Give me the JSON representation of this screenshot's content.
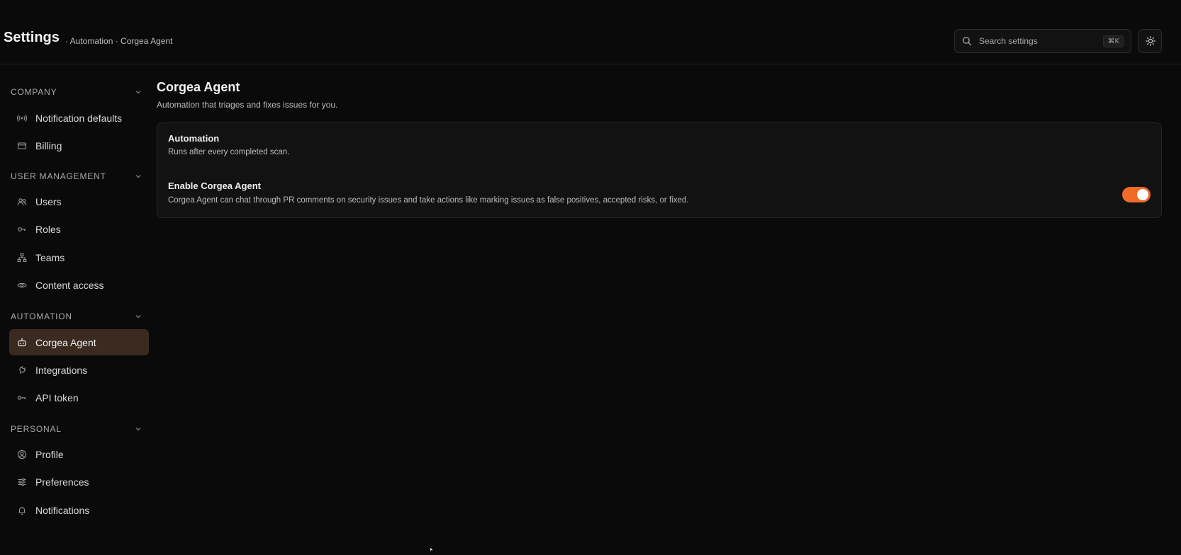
{
  "header": {
    "title": "Settings",
    "breadcrumb": "· Automation · Corgea Agent",
    "search": {
      "placeholder": "Search settings",
      "shortcut": "⌘K"
    },
    "theme_icon": "sun-icon"
  },
  "sidebar": {
    "sections": [
      {
        "label": "COMPANY",
        "items": [
          {
            "label": "Notification defaults",
            "icon": "broadcast-icon"
          },
          {
            "label": "Billing",
            "icon": "credit-card-icon"
          }
        ]
      },
      {
        "label": "USER MANAGEMENT",
        "items": [
          {
            "label": "Users",
            "icon": "users-icon"
          },
          {
            "label": "Roles",
            "icon": "key-icon"
          },
          {
            "label": "Teams",
            "icon": "hierarchy-icon"
          },
          {
            "label": "Content access",
            "icon": "eye-icon"
          }
        ]
      },
      {
        "label": "AUTOMATION",
        "items": [
          {
            "label": "Corgea Agent",
            "icon": "robot-icon",
            "active": true
          },
          {
            "label": "Integrations",
            "icon": "plug-icon"
          },
          {
            "label": "API token",
            "icon": "key-horizontal-icon"
          }
        ]
      },
      {
        "label": "PERSONAL",
        "items": [
          {
            "label": "Profile",
            "icon": "user-circle-icon"
          },
          {
            "label": "Preferences",
            "icon": "sliders-icon"
          },
          {
            "label": "Notifications",
            "icon": "bell-icon"
          }
        ]
      }
    ]
  },
  "main": {
    "title": "Corgea Agent",
    "subtitle": "Automation that triages and fixes issues for you.",
    "card": {
      "title": "Automation",
      "description": "Runs after every completed scan.",
      "setting": {
        "title": "Enable Corgea Agent",
        "description": "Corgea Agent can chat through PR comments on security issues and take actions like marking issues as false positives, accepted risks, or fixed.",
        "enabled": true
      }
    }
  },
  "colors": {
    "background": "#0a0a0a",
    "accent": "#f06a28",
    "active_nav": "#3a2a20"
  }
}
